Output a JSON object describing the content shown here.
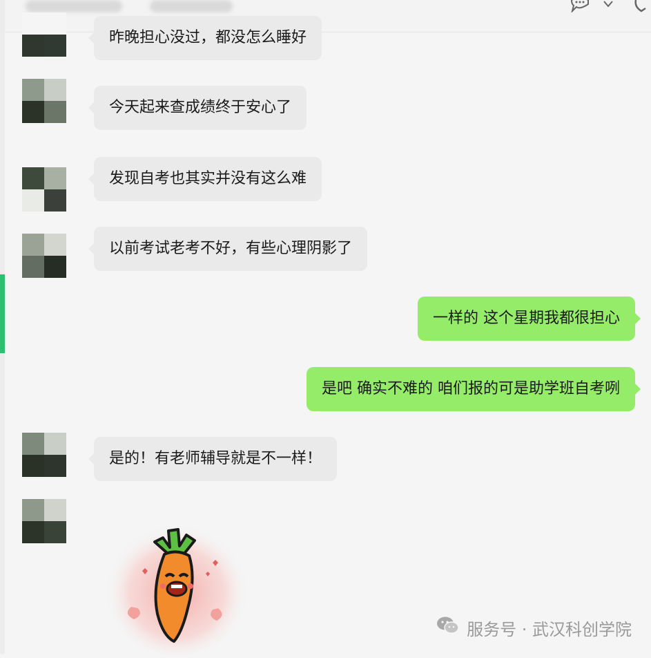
{
  "messages": [
    {
      "text": "昨晚担心没过，都没怎么睡好"
    },
    {
      "text": "今天起来查成绩终于安心了"
    },
    {
      "text": "发现自考也其实并没有这么难"
    },
    {
      "text": "以前考试老考不好，有些心理阴影了"
    },
    {
      "text": "一样的  这个星期我都很担心"
    },
    {
      "text": "是吧   确实不难的   咱们报的可是助学班自考咧"
    },
    {
      "text": "是的！有老师辅导就是不一样！"
    }
  ],
  "watermark": {
    "text": "服务号 · 武汉科创学院"
  },
  "colors": {
    "incoming": "#eaeaea",
    "outgoing": "#95ec69",
    "accent": "#2fbf71"
  },
  "icons": {
    "chat": "chat-bubble-icon",
    "chevron": "chevron-down-icon",
    "phone": "phone-icon",
    "wechat": "wechat-icon"
  }
}
